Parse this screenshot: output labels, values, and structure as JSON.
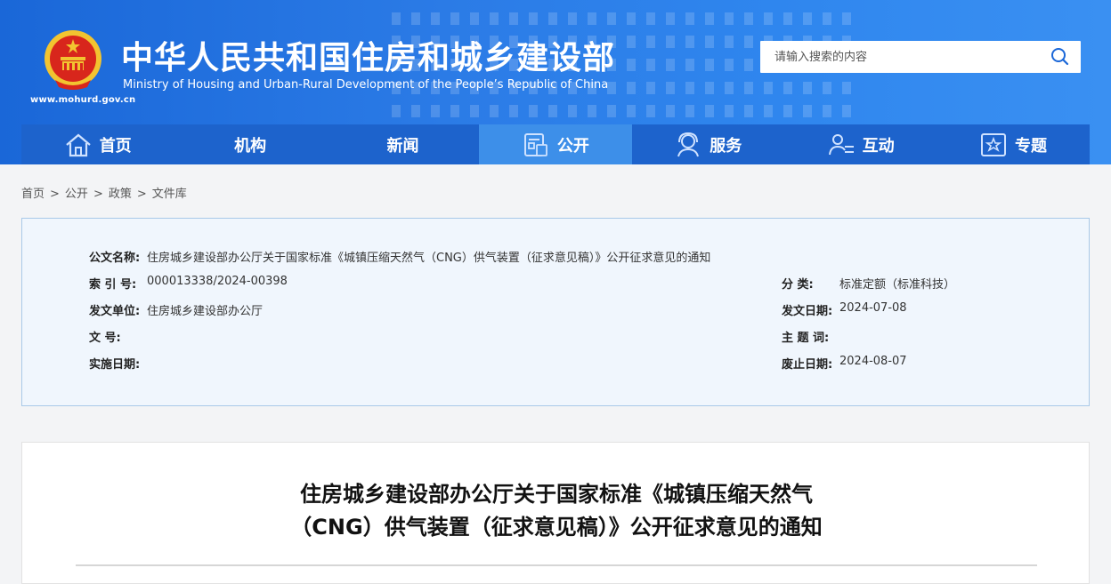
{
  "site": {
    "title_cn": "中华人民共和国住房和城乡建设部",
    "title_en": "Ministry of Housing and Urban-Rural Development of the People’s Republic of China",
    "domain": "www.mohurd.gov.cn"
  },
  "search": {
    "placeholder": "请输入搜索的内容",
    "icon": "search-icon"
  },
  "nav": {
    "items": [
      {
        "label": "首页",
        "icon": "home-icon"
      },
      {
        "label": "机构",
        "icon": ""
      },
      {
        "label": "新闻",
        "icon": ""
      },
      {
        "label": "公开",
        "icon": "document-icon",
        "active": true
      },
      {
        "label": "服务",
        "icon": "service-icon"
      },
      {
        "label": "互动",
        "icon": "interaction-icon"
      },
      {
        "label": "专题",
        "icon": "star-icon"
      }
    ]
  },
  "breadcrumb": {
    "items": [
      "首页",
      "公开",
      "政策",
      "文件库"
    ],
    "separator": ">"
  },
  "meta": {
    "doc_name_label": "公文名称:",
    "doc_name": "住房城乡建设部办公厅关于国家标准《城镇压缩天然气（CNG）供气装置（征求意见稿）》公开征求意见的通知",
    "index_label": "索  引  号:",
    "index": "000013338/2024-00398",
    "category_label": "分      类:",
    "category": "标准定额（标准科技）",
    "issuer_label": "发文单位:",
    "issuer": "住房城乡建设部办公厅",
    "date_label": "发文日期:",
    "date": "2024-07-08",
    "doc_no_label": "文      号:",
    "doc_no": "",
    "keywords_label": "主  题  词:",
    "keywords": "",
    "effective_label": "实施日期:",
    "effective": "",
    "expiry_label": "废止日期:",
    "expiry": "2024-08-07"
  },
  "article": {
    "title_line1": "住房城乡建设部办公厅关于国家标准《城镇压缩天然气",
    "title_line2": "（CNG）供气装置（征求意见稿）》公开征求意见的通知"
  },
  "colors": {
    "header_blue": "#1a67d8",
    "nav_blue": "#1d63cc",
    "nav_active": "#3d8fe9",
    "meta_bg": "#f0f6fd",
    "meta_border": "#a9c9e8"
  }
}
